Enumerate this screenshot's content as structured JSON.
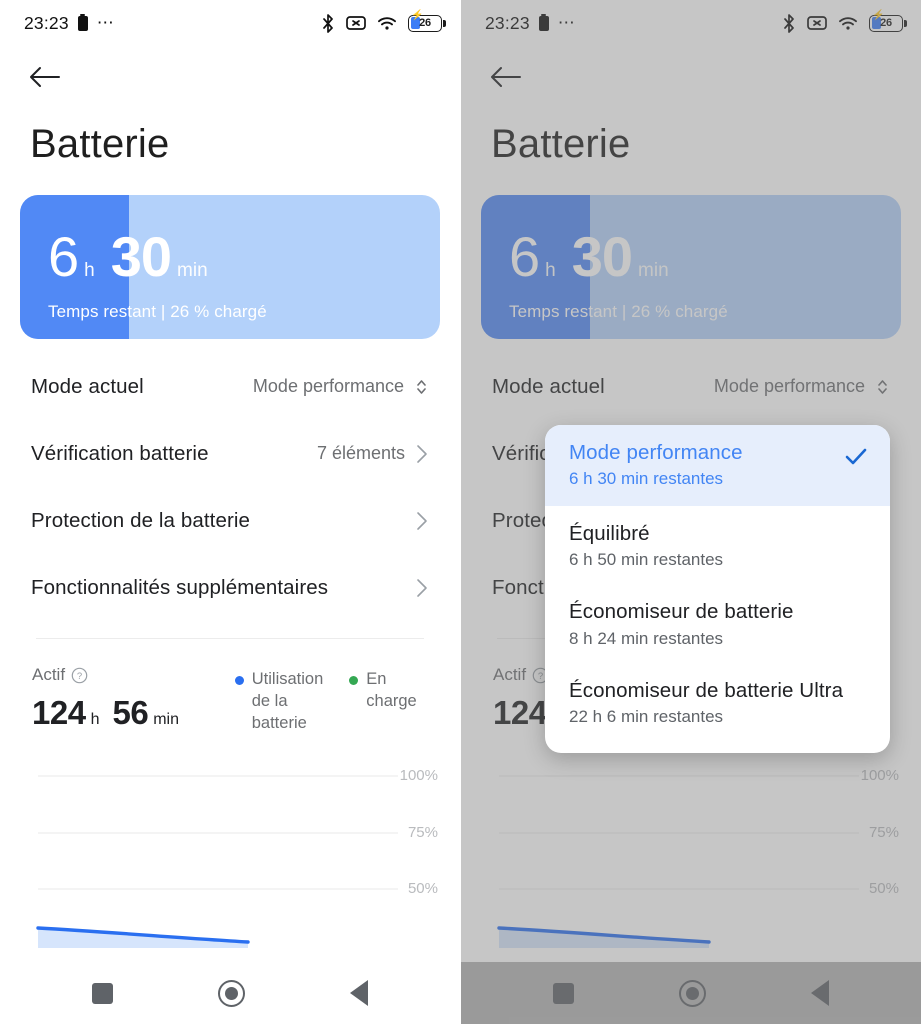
{
  "status_bar": {
    "time": "23:23",
    "battery_percent_label": "26",
    "icons": [
      "battery-small-icon",
      "ellipsis-icon",
      "bluetooth-icon",
      "mute-icon",
      "wifi-icon",
      "battery-charging-icon"
    ]
  },
  "header": {
    "back_label": "back-arrow",
    "title": "Batterie"
  },
  "battery_card": {
    "hours": "6",
    "hours_unit": "h",
    "minutes": "30",
    "minutes_unit": "min",
    "subtitle": "Temps restant | 26 % chargé",
    "fill_percent": 26,
    "fill_color": "#5189f5",
    "track_color": "#b3d1fa"
  },
  "settings_rows": [
    {
      "label": "Mode actuel",
      "value": "Mode performance",
      "indicator": "updown-chevron-icon"
    },
    {
      "label": "Vérification batterie",
      "value": "7 éléments",
      "indicator": "chevron-right-icon"
    },
    {
      "label": "Protection de la batterie",
      "value": "",
      "indicator": "chevron-right-icon"
    },
    {
      "label": "Fonctionnalités supplémentaires",
      "value": "",
      "indicator": "chevron-right-icon"
    }
  ],
  "stats": {
    "active_label": "Actif",
    "active_hours": "124",
    "active_hours_unit": "h",
    "active_minutes": "56",
    "active_minutes_unit": "min",
    "legend": [
      {
        "label": "Utilisation de la batterie",
        "color": "#2a6ff0"
      },
      {
        "label": "En charge",
        "color": "#34a853"
      }
    ]
  },
  "dropdown": {
    "items": [
      {
        "title": "Mode performance",
        "subtitle": "6 h 30 min restantes",
        "selected": true
      },
      {
        "title": "Équilibré",
        "subtitle": "6 h 50 min restantes",
        "selected": false
      },
      {
        "title": "Économiseur de batterie",
        "subtitle": "8 h 24 min restantes",
        "selected": false
      },
      {
        "title": "Économiseur de batterie Ultra",
        "subtitle": "22 h 6 min restantes",
        "selected": false
      }
    ],
    "selected_accent": "#4285f4"
  },
  "nav_bar": {
    "recents": "square-icon",
    "home": "circle-icon",
    "back": "triangle-back-icon"
  },
  "chart_data": {
    "type": "line",
    "title": "",
    "xlabel": "",
    "ylabel": "",
    "ylim": [
      0,
      100
    ],
    "grid": true,
    "tick_labels": [
      "100%",
      "75%",
      "50%"
    ],
    "tick_values": [
      100,
      75,
      50
    ],
    "series": [
      {
        "name": "Utilisation de la batterie",
        "color": "#2a6ff0",
        "x": [
          0,
          12,
          25,
          38,
          50,
          62,
          75,
          88,
          100
        ],
        "values": [
          28,
          27.6,
          27.3,
          27.0,
          26.8,
          26.6,
          26.4,
          26.2,
          26
        ]
      },
      {
        "name": "En charge",
        "color": "#34a853",
        "x": [],
        "values": []
      }
    ]
  }
}
